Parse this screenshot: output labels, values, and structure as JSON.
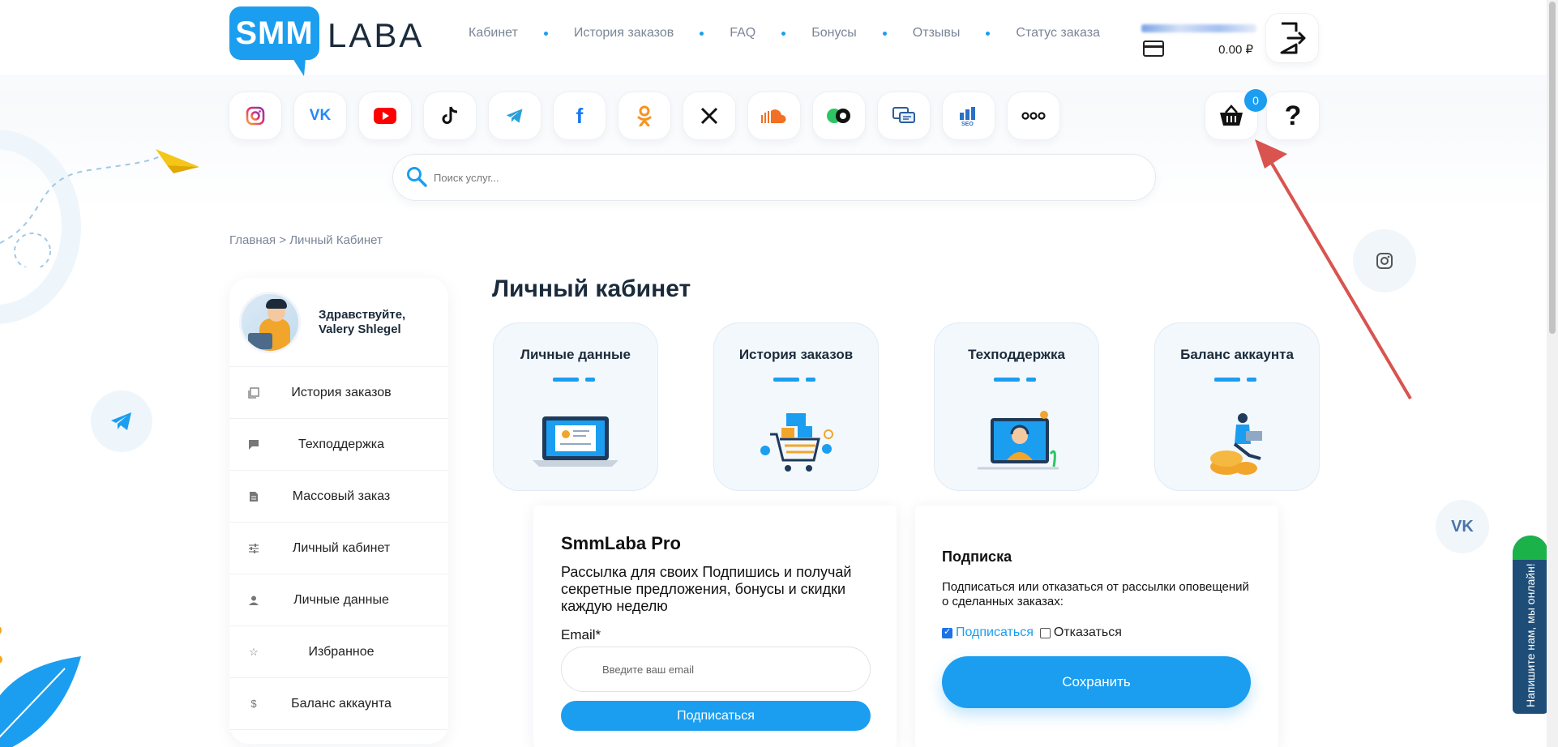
{
  "logo": {
    "mark": "SMM",
    "text": "LABA"
  },
  "nav": [
    {
      "label": "Кабинет"
    },
    {
      "label": "История заказов"
    },
    {
      "label": "FAQ"
    },
    {
      "label": "Бонусы"
    },
    {
      "label": "Отзывы"
    },
    {
      "label": "Статус заказа"
    }
  ],
  "header": {
    "balance": "0.00 ₽"
  },
  "social_icons": [
    "instagram-icon",
    "vk-icon",
    "youtube-icon",
    "tiktok-icon",
    "telegram-icon",
    "facebook-icon",
    "odnoklassniki-icon",
    "x-icon",
    "soundcloud-icon",
    "music-icon",
    "chat-icon",
    "seo-icon",
    "more-icon"
  ],
  "cart": {
    "count": "0"
  },
  "help": {
    "label": "?"
  },
  "search": {
    "placeholder": "Поиск услуг..."
  },
  "breadcrumb": {
    "home": "Главная",
    "sep": ">",
    "current": "Личный Кабинет"
  },
  "sidebar": {
    "greeting": "Здравствуйте,",
    "user_name": "Valery Shlegel",
    "items": [
      {
        "label": "История заказов",
        "icon": "orders-icon"
      },
      {
        "label": "Техподдержка",
        "icon": "support-chat-icon"
      },
      {
        "label": "Массовый заказ",
        "icon": "document-icon"
      },
      {
        "label": "Личный кабинет",
        "icon": "sliders-icon"
      },
      {
        "label": "Личные данные",
        "icon": "person-icon"
      },
      {
        "label": "Избранное",
        "icon": "star-icon"
      },
      {
        "label": "Баланс аккаунта",
        "icon": "dollar-icon"
      }
    ]
  },
  "main": {
    "title": "Личный кабинет",
    "tiles": [
      {
        "label": "Личные данные"
      },
      {
        "label": "История заказов"
      },
      {
        "label": "Техподдержка"
      },
      {
        "label": "Баланс аккаунта"
      }
    ]
  },
  "pro": {
    "title": "SmmLaba Pro",
    "description": "Рассылка для своих Подпишись и получай секретные предложения, бонусы и скидки каждую неделю",
    "email_label": "Email*",
    "email_placeholder": "Введите ваш email",
    "subscribe_button": "Подписаться"
  },
  "subscription": {
    "title": "Подписка",
    "description": "Подписаться или отказаться от рассылки оповещений о сделанных заказах:",
    "option_subscribe": "Подписаться",
    "option_unsubscribe": "Отказаться",
    "subscribe_checked": true,
    "save_button": "Сохранить"
  },
  "chat_widget": {
    "text": "Напишите нам, мы онлайн!"
  },
  "colors": {
    "accent": "#1b9ef0",
    "text_dark": "#1b2b3b",
    "muted": "#7a8596",
    "annotation_arrow": "#d9534f"
  }
}
